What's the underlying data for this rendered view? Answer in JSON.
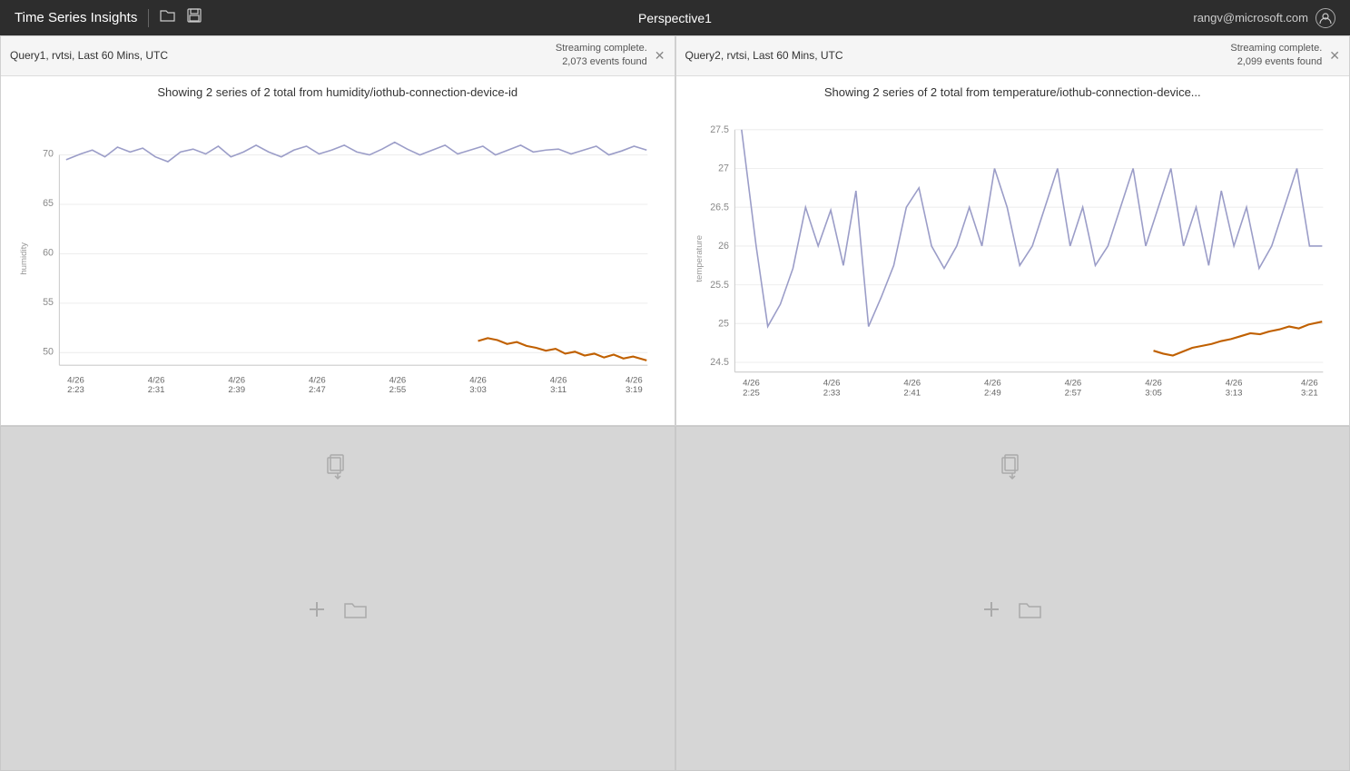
{
  "header": {
    "title": "Time Series Insights",
    "perspective": "Perspective1",
    "user": "rangv@microsoft.com",
    "open_icon": "📂",
    "save_icon": "💾"
  },
  "panels": [
    {
      "id": "panel-1",
      "type": "chart",
      "title": "Query1, rvtsi, Last 60 Mins, UTC",
      "status_line1": "Streaming complete.",
      "status_line2": "2,073 events found",
      "chart_title": "Showing 2 series of 2 total from humidity/iothub-connection-device-id",
      "y_axis_label": "humidity",
      "y_ticks": [
        "70",
        "65",
        "60",
        "55",
        "50"
      ],
      "x_ticks": [
        "4/26\n2:23",
        "4/26\n2:31",
        "4/26\n2:39",
        "4/26\n2:47",
        "4/26\n2:55",
        "4/26\n3:03",
        "4/26\n3:11",
        "4/26\n3:19"
      ]
    },
    {
      "id": "panel-2",
      "type": "chart",
      "title": "Query2, rvtsi, Last 60 Mins, UTC",
      "status_line1": "Streaming complete.",
      "status_line2": "2,099 events found",
      "chart_title": "Showing 2 series of 2 total from temperature/iothub-connection-device...",
      "y_axis_label": "temperature",
      "y_ticks": [
        "27.5",
        "27",
        "26.5",
        "26",
        "25.5",
        "25",
        "24.5"
      ],
      "x_ticks": [
        "4/26\n2:25",
        "4/26\n2:33",
        "4/26\n2:41",
        "4/26\n2:49",
        "4/26\n2:57",
        "4/26\n3:05",
        "4/26\n3:13",
        "4/26\n3:21"
      ]
    },
    {
      "id": "panel-3",
      "type": "empty"
    },
    {
      "id": "panel-4",
      "type": "empty"
    }
  ]
}
